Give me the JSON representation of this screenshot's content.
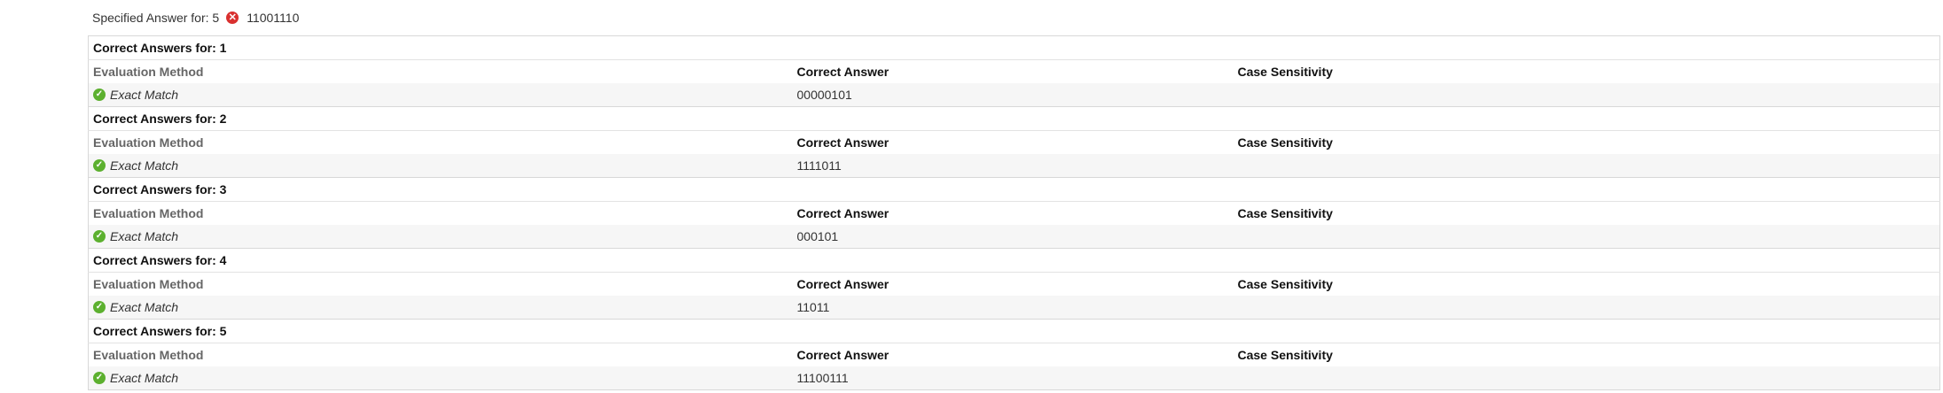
{
  "specified": {
    "label": "Specified Answer for: 5",
    "status_icon": "incorrect-x-icon",
    "value": "11001110"
  },
  "headers": {
    "evaluation_method": "Evaluation Method",
    "correct_answer": "Correct Answer",
    "case_sensitivity": "Case Sensitivity"
  },
  "groups": [
    {
      "title": "Correct Answers for: 1",
      "method": "Exact Match",
      "answer": "00000101",
      "case": ""
    },
    {
      "title": "Correct Answers for: 2",
      "method": "Exact Match",
      "answer": "1111011",
      "case": ""
    },
    {
      "title": "Correct Answers for: 3",
      "method": "Exact Match",
      "answer": "000101",
      "case": ""
    },
    {
      "title": "Correct Answers for: 4",
      "method": "Exact Match",
      "answer": "11011",
      "case": ""
    },
    {
      "title": "Correct Answers for: 5",
      "method": "Exact Match",
      "answer": "11100111",
      "case": ""
    }
  ],
  "colors": {
    "incorrect": "#d9302f",
    "correct": "#5cb02f"
  }
}
